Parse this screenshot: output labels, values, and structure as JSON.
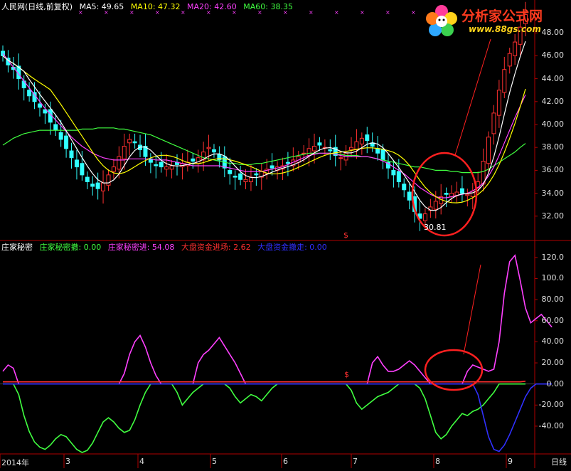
{
  "header_top": {
    "title": "人民网(日线,前复权)",
    "ma5": "MA5: 49.65",
    "ma10": "MA10: 47.32",
    "ma20": "MA20: 42.60",
    "ma60": "MA60: 38.35"
  },
  "header_bottom": {
    "name": "庄家秘密",
    "s1": "庄家秘密撤: 0.00",
    "s2": "庄家秘密进: 54.08",
    "s3": "大盘资金进场: 2.62",
    "s4": "大盘资金撤走: 0.00"
  },
  "logo": {
    "title": "分析家公式网",
    "url": "www.88gs.com"
  },
  "low_label": "30.81",
  "daily_label": "日线",
  "colors": {
    "ma5": "#ffffff",
    "ma10": "#ffff00",
    "ma20": "#ff40ff",
    "ma60": "#40ff40",
    "up": "#ff3030",
    "down": "#30ffff",
    "axis": "#b00000",
    "circle": "#ff2020",
    "s1": "#40ff40",
    "s2": "#ff40ff",
    "s3": "#ff3030",
    "s4": "#3030ff"
  },
  "chart_data": [
    {
      "type": "candlestick",
      "title": "人民网(日线,前复权)",
      "ylim": [
        30,
        50
      ],
      "yticks": [
        "48.00",
        "46.00",
        "44.00",
        "42.00",
        "40.00",
        "38.00",
        "36.00",
        "34.00",
        "32.00"
      ],
      "ytick_values": [
        48,
        46,
        44,
        42,
        40,
        38,
        36,
        34,
        32
      ],
      "x_labels": [
        "2014年",
        "3",
        "4",
        "5",
        "6",
        "7",
        "8",
        "9"
      ],
      "close": [
        46.0,
        45.2,
        44.8,
        44.0,
        43.2,
        42.5,
        42.0,
        41.5,
        41.0,
        40.2,
        39.5,
        38.7,
        37.9,
        37.1,
        36.3,
        35.6,
        35.0,
        34.6,
        34.4,
        34.9,
        35.6,
        36.3,
        37.2,
        38.1,
        38.7,
        38.4,
        37.8,
        37.2,
        36.7,
        36.4,
        36.3,
        36.3,
        36.4,
        36.5,
        36.6,
        36.7,
        36.8,
        37.1,
        37.6,
        38.0,
        37.6,
        36.9,
        36.2,
        35.7,
        35.4,
        35.2,
        35.2,
        35.4,
        35.6,
        35.9,
        36.1,
        36.2,
        36.3,
        36.4,
        36.6,
        36.9,
        37.2,
        37.5,
        37.9,
        38.1,
        38.2,
        38.0,
        37.7,
        37.3,
        37.1,
        37.5,
        38.0,
        38.5,
        38.8,
        38.6,
        38.1,
        37.5,
        36.9,
        36.2,
        35.6,
        35.0,
        34.3,
        33.4,
        32.4,
        31.8,
        32.2,
        32.8,
        33.3,
        33.7,
        33.9,
        34.0,
        34.1,
        34.0,
        33.9,
        34.2,
        35.0,
        36.8,
        38.9,
        41.0,
        43.0,
        44.8,
        46.2,
        47.2,
        48.5,
        49.6
      ],
      "ma20": [
        46.2,
        45.6,
        45.0,
        44.4,
        43.8,
        43.2,
        42.6,
        42.0,
        41.4,
        40.9,
        40.4,
        39.9,
        39.4,
        38.9,
        38.5,
        38.1,
        37.8,
        37.5,
        37.3,
        37.1,
        37.0,
        36.9,
        36.9,
        36.9,
        37.0,
        37.0,
        37.0,
        37.0,
        37.0,
        36.9,
        36.9,
        36.9,
        36.8,
        36.7,
        36.6,
        36.5,
        36.4,
        36.4,
        36.4,
        36.4,
        36.4,
        36.4,
        36.3,
        36.2,
        36.1,
        36.0,
        35.9,
        35.9,
        35.9,
        35.9,
        36.0,
        36.1,
        36.2,
        36.3,
        36.5,
        36.7,
        36.9,
        37.1,
        37.3,
        37.4,
        37.5,
        37.5,
        37.5,
        37.4,
        37.3,
        37.2,
        37.2,
        37.2,
        37.2,
        37.2,
        37.1,
        37.0,
        36.8,
        36.6,
        36.3,
        36.0,
        35.7,
        35.3,
        34.9,
        34.5,
        34.2,
        33.9,
        33.7,
        33.6,
        33.6,
        33.7,
        33.8,
        33.9,
        34.0,
        34.2,
        34.5,
        34.9,
        35.5,
        36.3,
        37.3,
        38.4,
        39.5,
        40.6,
        41.6,
        42.6
      ],
      "ma60": [
        38.2,
        38.5,
        38.8,
        39.0,
        39.2,
        39.3,
        39.4,
        39.5,
        39.5,
        39.5,
        39.5,
        39.5,
        39.5,
        39.5,
        39.5,
        39.6,
        39.6,
        39.6,
        39.7,
        39.7,
        39.7,
        39.7,
        39.6,
        39.6,
        39.5,
        39.4,
        39.3,
        39.2,
        39.1,
        38.9,
        38.7,
        38.5,
        38.3,
        38.1,
        37.9,
        37.7,
        37.5,
        37.3,
        37.1,
        37.0,
        36.9,
        36.8,
        36.7,
        36.6,
        36.6,
        36.5,
        36.5,
        36.5,
        36.6,
        36.6,
        36.7,
        36.8,
        36.9,
        37.0,
        37.1,
        37.2,
        37.3,
        37.4,
        37.5,
        37.5,
        37.5,
        37.5,
        37.5,
        37.4,
        37.4,
        37.3,
        37.3,
        37.3,
        37.2,
        37.2,
        37.1,
        37.0,
        36.9,
        36.8,
        36.7,
        36.6,
        36.5,
        36.4,
        36.3,
        36.3,
        36.2,
        36.1,
        36.0,
        36.0,
        36.0,
        35.9,
        35.9,
        35.8,
        35.8,
        35.8,
        35.8,
        35.9,
        36.1,
        36.4,
        36.7,
        37.0,
        37.3,
        37.6,
        38.0,
        38.35
      ]
    },
    {
      "type": "line",
      "title": "庄家秘密",
      "ylim": [
        -65,
        128
      ],
      "yticks": [
        "120.0",
        "100.0",
        "80.00",
        "60.00",
        "40.00",
        "20.00",
        "0.00",
        "-20.00",
        "-40.00"
      ],
      "ytick_values": [
        120,
        100,
        80,
        60,
        40,
        20,
        0,
        -20,
        -40
      ],
      "series": [
        {
          "name": "庄家秘密撤",
          "color": "#40ff40",
          "values": [
            0,
            0,
            0,
            -10,
            -30,
            -45,
            -55,
            -60,
            -62,
            -58,
            -52,
            -48,
            -50,
            -56,
            -62,
            -65,
            -63,
            -56,
            -46,
            -36,
            -32,
            -36,
            -42,
            -46,
            -44,
            -34,
            -20,
            -8,
            0,
            0,
            0,
            0,
            0,
            -8,
            -20,
            -14,
            -8,
            -4,
            0,
            0,
            0,
            0,
            0,
            -4,
            -12,
            -18,
            -14,
            -10,
            -12,
            -16,
            -10,
            -4,
            0,
            0,
            0,
            0,
            0,
            0,
            0,
            0,
            0,
            0,
            0,
            0,
            0,
            0,
            -6,
            -18,
            -24,
            -20,
            -16,
            -12,
            -10,
            -8,
            -4,
            0,
            0,
            0,
            0,
            -4,
            -14,
            -30,
            -46,
            -52,
            -48,
            -40,
            -34,
            -28,
            -30,
            -26,
            -24,
            -20,
            -14,
            -8,
            0,
            0,
            0,
            0,
            0,
            0
          ]
        },
        {
          "name": "庄家秘密进",
          "color": "#ff40ff",
          "values": [
            12,
            18,
            15,
            0,
            0,
            0,
            0,
            0,
            0,
            0,
            0,
            0,
            0,
            0,
            0,
            0,
            0,
            0,
            0,
            0,
            0,
            0,
            0,
            10,
            28,
            40,
            46,
            35,
            20,
            8,
            0,
            0,
            0,
            0,
            0,
            0,
            0,
            20,
            28,
            32,
            38,
            44,
            36,
            28,
            20,
            10,
            0,
            0,
            0,
            0,
            0,
            0,
            0,
            0,
            0,
            0,
            0,
            0,
            0,
            0,
            0,
            0,
            0,
            0,
            0,
            0,
            0,
            0,
            0,
            0,
            20,
            26,
            18,
            12,
            12,
            14,
            18,
            22,
            18,
            12,
            6,
            0,
            0,
            0,
            0,
            0,
            0,
            0,
            12,
            18,
            16,
            14,
            12,
            14,
            40,
            86,
            116,
            122,
            98,
            72,
            58,
            62,
            66,
            60,
            54
          ]
        },
        {
          "name": "大盘资金进场",
          "color": "#ff3030",
          "values": [
            2,
            2,
            2,
            2,
            2,
            2,
            2,
            2,
            2,
            2,
            2,
            2,
            2,
            2,
            2,
            2,
            2,
            2,
            2,
            2,
            2,
            2,
            2,
            2,
            2,
            2,
            2,
            2,
            2,
            2,
            2,
            2,
            2,
            2,
            2,
            2,
            2,
            2,
            2,
            2,
            2,
            2,
            2,
            2,
            2,
            2,
            2,
            2,
            2,
            2,
            2,
            2,
            2,
            2,
            2,
            2,
            2,
            2,
            2,
            2,
            2,
            2,
            2,
            2,
            2,
            2,
            2,
            2,
            2,
            2,
            2,
            2,
            2,
            2,
            2,
            2,
            2,
            2,
            2,
            2,
            2,
            2,
            2,
            2,
            2,
            2,
            2,
            2,
            2,
            2,
            2,
            2,
            2,
            2,
            2,
            2,
            2,
            2,
            2,
            2.62
          ]
        },
        {
          "name": "大盘资金撤走",
          "color": "#3030ff",
          "values": [
            0,
            0,
            0,
            0,
            0,
            0,
            0,
            0,
            0,
            0,
            0,
            0,
            0,
            0,
            0,
            0,
            0,
            0,
            0,
            0,
            0,
            0,
            0,
            0,
            0,
            0,
            0,
            0,
            0,
            0,
            0,
            0,
            0,
            0,
            0,
            0,
            0,
            0,
            0,
            0,
            0,
            0,
            0,
            0,
            0,
            0,
            0,
            0,
            0,
            0,
            0,
            0,
            0,
            0,
            0,
            0,
            0,
            0,
            0,
            0,
            0,
            0,
            0,
            0,
            0,
            0,
            0,
            0,
            0,
            0,
            0,
            0,
            0,
            0,
            0,
            0,
            0,
            0,
            0,
            0,
            0,
            0,
            0,
            0,
            0,
            0,
            0,
            0,
            0,
            0,
            -10,
            -30,
            -50,
            -62,
            -64,
            -58,
            -48,
            -36,
            -24,
            -12,
            -4,
            0,
            0,
            0,
            0
          ]
        }
      ]
    }
  ]
}
